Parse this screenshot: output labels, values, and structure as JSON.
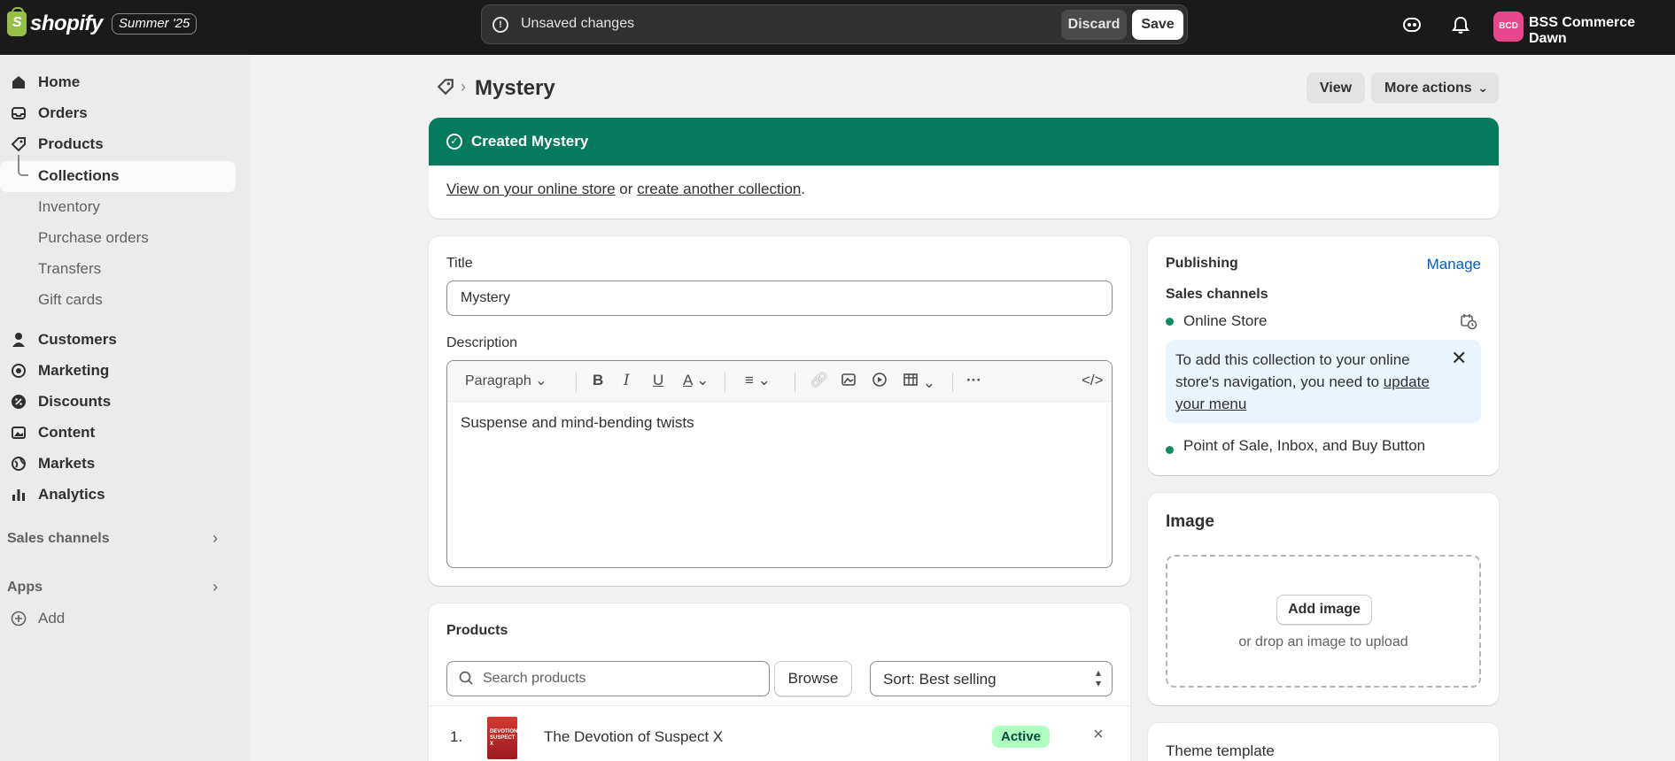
{
  "topbar": {
    "logo_text": "shopify",
    "badge": "Summer '25",
    "unsaved_text": "Unsaved changes",
    "discard": "Discard",
    "save": "Save",
    "avatar_initials": "BCD",
    "store_name": "BSS Commerce Dawn"
  },
  "sidebar": {
    "items": [
      {
        "label": "Home",
        "icon": "home-icon"
      },
      {
        "label": "Orders",
        "icon": "inbox-icon"
      },
      {
        "label": "Products",
        "icon": "tag-icon"
      }
    ],
    "sub_items": [
      "Collections",
      "Inventory",
      "Purchase orders",
      "Transfers",
      "Gift cards"
    ],
    "items2": [
      {
        "label": "Customers",
        "icon": "person-icon"
      },
      {
        "label": "Marketing",
        "icon": "target-icon"
      },
      {
        "label": "Discounts",
        "icon": "discount-icon"
      },
      {
        "label": "Content",
        "icon": "image-icon"
      },
      {
        "label": "Markets",
        "icon": "globe-icon"
      },
      {
        "label": "Analytics",
        "icon": "bar-chart-icon"
      }
    ],
    "sales_channels": "Sales channels",
    "apps": "Apps",
    "add": "Add"
  },
  "page": {
    "title": "Mystery",
    "view_button": "View",
    "more_actions": "More actions"
  },
  "banner": {
    "title": "Created Mystery",
    "link1": "View on your online store",
    "middle": " or ",
    "link2": "create another collection",
    "end": "."
  },
  "details": {
    "title_label": "Title",
    "title_value": "Mystery",
    "description_label": "Description",
    "paragraph_select": "Paragraph",
    "description_value": "Suspense and mind-bending twists"
  },
  "publishing": {
    "title": "Publishing",
    "manage": "Manage",
    "sales_channels": "Sales channels",
    "online_store": "Online Store",
    "info_text": "To add this collection to your online store's navigation, you need to ",
    "info_link": "update your menu",
    "pos": "Point of Sale, Inbox, and Buy Button"
  },
  "image": {
    "title": "Image",
    "add_image": "Add image",
    "drop_text": "or drop an image to upload"
  },
  "theme": {
    "title": "Theme template"
  },
  "products": {
    "title": "Products",
    "search_placeholder": "Search products",
    "browse": "Browse",
    "sort": "Sort: Best selling",
    "rows": [
      {
        "index": "1.",
        "name": "The Devotion of Suspect X",
        "status": "Active",
        "cover_text": "DEVOTION SUSPECT X"
      }
    ]
  },
  "colors": {
    "banner_green": "#047b5d",
    "active_badge": "#affebf",
    "link_blue": "#005bd3",
    "avatar_pink": "#e8478c"
  }
}
